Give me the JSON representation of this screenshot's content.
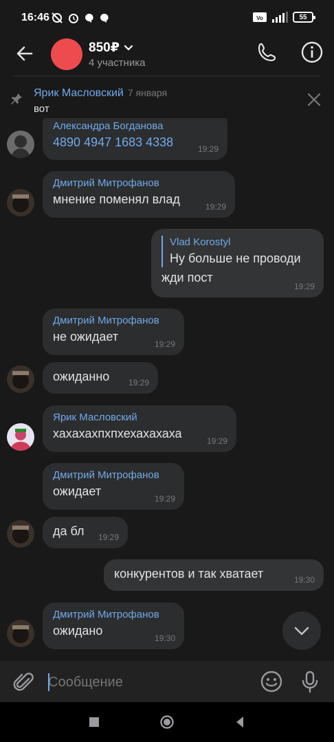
{
  "status_bar": {
    "time": "16:46",
    "battery": "55",
    "net_label": "4G",
    "volte_label": "Vo LTE"
  },
  "header": {
    "title": "850₽",
    "subtitle": "4 участника"
  },
  "pinned": {
    "author": "Ярик Масловский",
    "date": "7 января",
    "text": "вот"
  },
  "messages": [
    {
      "sender": "Александра Богданова",
      "text": "4890 4947 1683 4338",
      "time": "19:29"
    },
    {
      "sender": "Дмитрий Митрофанов",
      "text": "мнение поменял влад",
      "time": "19:29"
    },
    {
      "reply_name": "Vlad Korostyl",
      "reply_text": "Ну больше не проводи",
      "text": "жди пост",
      "time": "19:29"
    },
    {
      "sender": "Дмитрий Митрофанов",
      "text": "не ожидает",
      "time": "19:29"
    },
    {
      "text": "ожиданно",
      "time": "19:29"
    },
    {
      "sender": "Ярик Масловский",
      "text": "хахахахпхпхехахахаха",
      "time": "19:29"
    },
    {
      "sender": "Дмитрий Митрофанов",
      "text": "ожидает",
      "time": "19:29"
    },
    {
      "text": "да бл",
      "time": "19:29"
    },
    {
      "text": "конкурентов и так хватает",
      "time": "19:30"
    },
    {
      "sender": "Дмитрий Митрофанов",
      "text": "ожидано",
      "time": "19:30"
    }
  ],
  "composer": {
    "placeholder": "Сообщение"
  },
  "colors": {
    "accent": "#71aaeb",
    "background": "#191919",
    "bubble": "#2c2d2e",
    "avatar": "#ee4b4f"
  }
}
